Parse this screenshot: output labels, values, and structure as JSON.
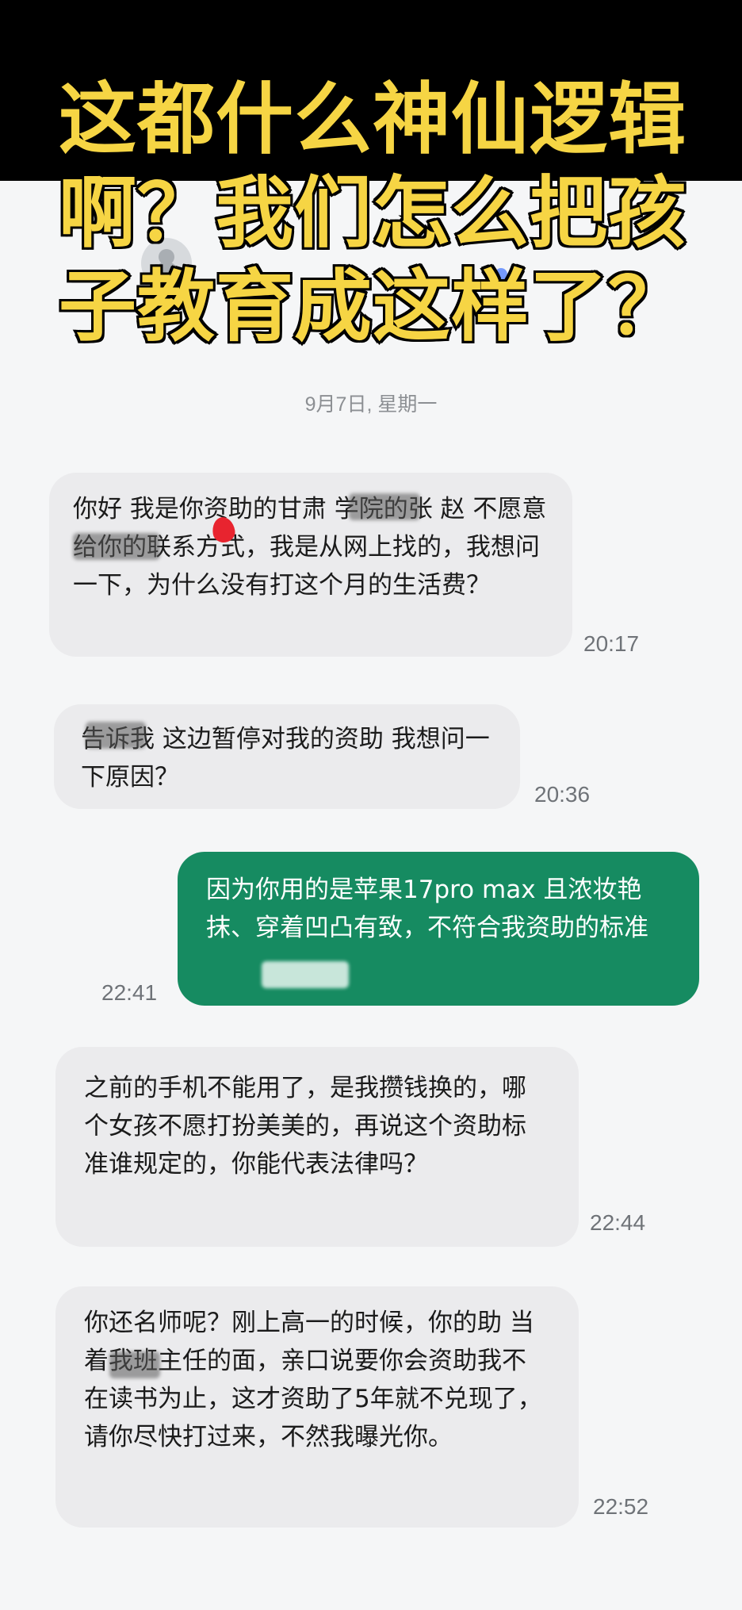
{
  "title_lines": [
    "这都什么神仙逻辑",
    "啊？我们怎么把孩",
    "子教育成这样了？"
  ],
  "date_label": "9月7日, 星期一",
  "messages": [
    {
      "direction": "incoming",
      "text": "你好 我是你资助的甘肃 学院的张 赵 不愿意给你的联系方式，我是从网上找的，我想问一下，为什么没有打这个月的生活费？",
      "time": "20:17"
    },
    {
      "direction": "incoming",
      "text": "告诉我 这边暂停对我的资助 我想问一下原因？",
      "time": "20:36"
    },
    {
      "direction": "outgoing",
      "text": "因为你用的是苹果17pro max 且浓妆艳抹、穿着凹凸有致，不符合我资助的标准",
      "time": "22:41"
    },
    {
      "direction": "incoming",
      "text": "之前的手机不能用了，是我攒钱换的，哪个女孩不愿打扮美美的，再说这个资助标准谁规定的，你能代表法律吗？",
      "time": "22:44"
    },
    {
      "direction": "incoming",
      "text": "你还名师呢？刚上高一的时候，你的助 当着我班主任的面，亲口说要你会资助我不在读书为止，这才资助了5年就不兑现了，请你尽快打过来，不然我曝光你。",
      "time": "22:52"
    }
  ],
  "colors": {
    "title_fill": "#f6d544",
    "incoming_bubble": "#ebebed",
    "outgoing_bubble": "#168b61",
    "panel_bg": "#f5f6f7"
  }
}
